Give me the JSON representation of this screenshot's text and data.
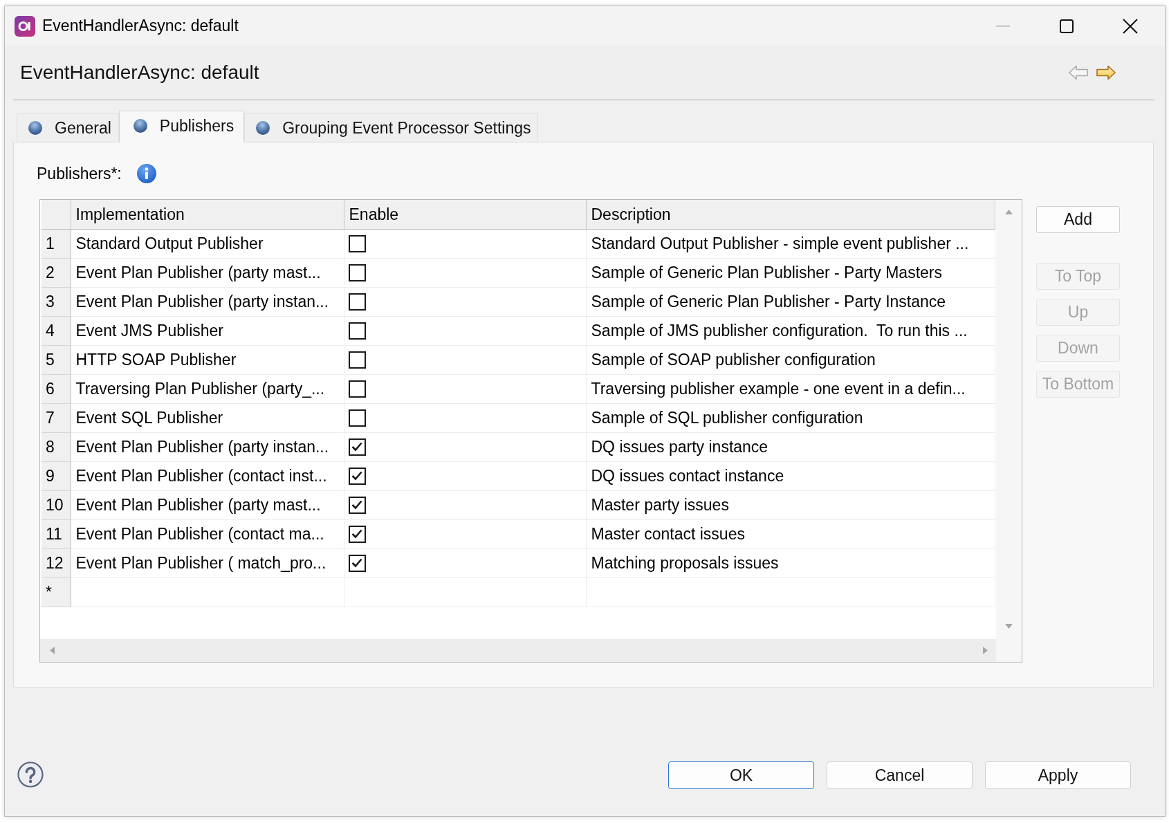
{
  "window": {
    "title": "EventHandlerAsync: default",
    "buttons": [
      {
        "kind": "minimize",
        "disabled": true
      },
      {
        "kind": "maximize",
        "disabled": false
      },
      {
        "kind": "close",
        "disabled": false
      }
    ]
  },
  "header": {
    "title": "EventHandlerAsync: default",
    "nav": [
      {
        "kind": "back",
        "disabled": true
      },
      {
        "kind": "forward",
        "disabled": false
      }
    ]
  },
  "tabs": [
    {
      "label": "General",
      "selected": false
    },
    {
      "label": "Publishers",
      "selected": true
    },
    {
      "label": "Grouping Event Processor Settings",
      "selected": false
    }
  ],
  "publishers": {
    "label": "Publishers*:",
    "table": {
      "columns": [
        "Implementation",
        "Enable",
        "Description"
      ],
      "rows": [
        {
          "number": "1",
          "implementation": "Standard Output Publisher",
          "checked": false,
          "description": "Standard Output Publisher - simple event publisher ..."
        },
        {
          "number": "2",
          "implementation": "Event Plan Publisher (party mast...",
          "checked": false,
          "description": "Sample of Generic Plan Publisher - Party Masters"
        },
        {
          "number": "3",
          "implementation": "Event Plan Publisher (party instan...",
          "checked": false,
          "description": "Sample of Generic Plan Publisher - Party Instance"
        },
        {
          "number": "4",
          "implementation": "Event JMS Publisher",
          "checked": false,
          "description": "Sample of JMS publisher configuration.  To run this ..."
        },
        {
          "number": "5",
          "implementation": "HTTP SOAP Publisher",
          "checked": false,
          "description": "Sample of SOAP publisher configuration"
        },
        {
          "number": "6",
          "implementation": "Traversing Plan Publisher (party_...",
          "checked": false,
          "description": "Traversing publisher example - one event in a defin..."
        },
        {
          "number": "7",
          "implementation": "Event SQL Publisher",
          "checked": false,
          "description": "Sample of SQL publisher configuration"
        },
        {
          "number": "8",
          "implementation": "Event Plan Publisher (party instan...",
          "checked": true,
          "description": "DQ issues party instance"
        },
        {
          "number": "9",
          "implementation": "Event Plan Publisher (contact inst...",
          "checked": true,
          "description": "DQ issues contact instance"
        },
        {
          "number": "10",
          "implementation": "Event Plan Publisher (party mast...",
          "checked": true,
          "description": "Master party issues"
        },
        {
          "number": "11",
          "implementation": "Event Plan Publisher (contact ma...",
          "checked": true,
          "description": "Master contact issues"
        },
        {
          "number": "12",
          "implementation": "Event Plan Publisher ( match_pro...",
          "checked": true,
          "description": "Matching proposals issues"
        }
      ],
      "new_row_marker": "*"
    },
    "buttons": [
      {
        "label": "Add",
        "disabled": false
      },
      {
        "label": "To Top",
        "disabled": true
      },
      {
        "label": "Up",
        "disabled": true
      },
      {
        "label": "Down",
        "disabled": true
      },
      {
        "label": "To Bottom",
        "disabled": true
      }
    ]
  },
  "footer": {
    "buttons": [
      {
        "label": "OK",
        "default": true
      },
      {
        "label": "Cancel",
        "default": false
      },
      {
        "label": "Apply",
        "default": false
      }
    ]
  }
}
